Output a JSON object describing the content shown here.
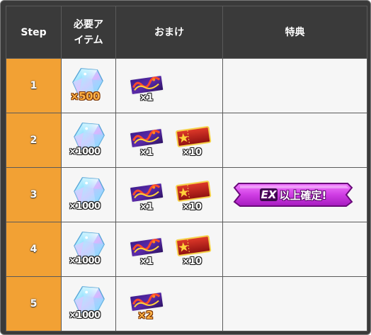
{
  "header": {
    "step": "Step",
    "required_item_line1": "必要ア",
    "required_item_line2": "イテム",
    "bonus": "おまけ",
    "perk": "特典"
  },
  "rows": [
    {
      "step": "1",
      "crystal_qty": "×500",
      "ticket_qty": "×1"
    },
    {
      "step": "2",
      "crystal_qty": "×1000",
      "ticket_qty": "×1",
      "voucher_qty": "×10"
    },
    {
      "step": "3",
      "crystal_qty": "×1000",
      "ticket_qty": "×1",
      "voucher_qty": "×10",
      "perk_ex": "EX",
      "perk_text": "以上確定!"
    },
    {
      "step": "4",
      "crystal_qty": "×1000",
      "ticket_qty": "×1",
      "voucher_qty": "×10"
    },
    {
      "step": "5",
      "crystal_qty": "×1000",
      "ticket_qty": "×2"
    }
  ],
  "colors": {
    "header_bg": "#3a3a3a",
    "step_bg": "#f2a134",
    "cell_bg": "#f6f6f6",
    "badge": "#d24fe0"
  },
  "icons": [
    "crystal-icon",
    "ticket-icon",
    "star-voucher-icon",
    "ex-guarantee-badge"
  ]
}
